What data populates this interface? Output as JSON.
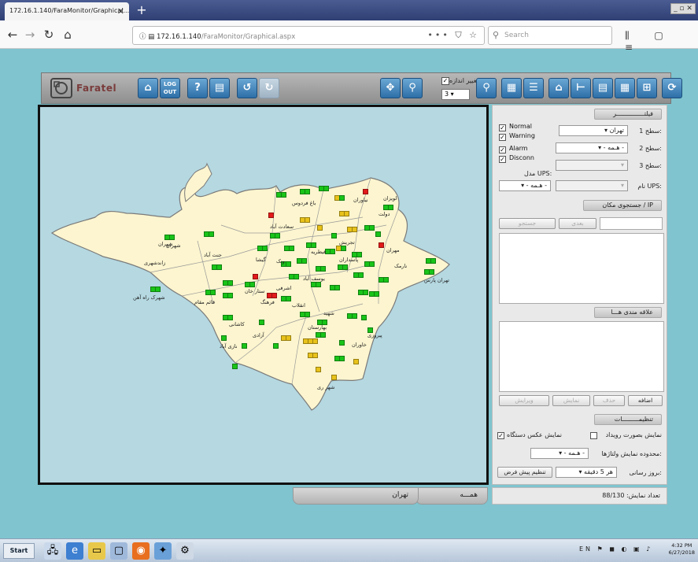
{
  "browser": {
    "tab_title": "172.16.1.140/FaraMonitor/Graphical...",
    "new_tab": "+",
    "window_controls": "_ ▫ ✕",
    "url_host": "172.16.1.140",
    "url_path": "/FaraMonitor/Graphical.aspx",
    "url_icons": "••• ⛉ ☆",
    "search_placeholder": "Search",
    "nav_right_icons": "⫼ ▢ ≡"
  },
  "toolbar": {
    "logo_text": "Faratel",
    "logout_label": "LOG OUT",
    "resize_label": "تغییر اندازه",
    "resize_value": "3",
    "resize_checked": "✓"
  },
  "map": {
    "labels": [
      {
        "t": "شهران"
      },
      {
        "t": "جنت آباد"
      },
      {
        "t": "زاندشهری"
      },
      {
        "t": "شهرک راه آهن"
      },
      {
        "t": "قائم مقام"
      },
      {
        "t": "ستار خان"
      },
      {
        "t": "اشرفی"
      },
      {
        "t": "فرهنگ"
      },
      {
        "t": "نیاوران"
      },
      {
        "t": "قیطریه"
      },
      {
        "t": "پاسداران"
      },
      {
        "t": "تجریش"
      },
      {
        "t": "مهران"
      },
      {
        "t": "نارمک"
      },
      {
        "t": "تهران پارس"
      },
      {
        "t": "سعادت آباد"
      },
      {
        "t": "ونک"
      },
      {
        "t": "یوسف آباد"
      },
      {
        "t": "انقلاب"
      },
      {
        "t": "بهارستان"
      },
      {
        "t": "نازی آباد"
      },
      {
        "t": "شهر ری"
      },
      {
        "t": "خاوران"
      },
      {
        "t": "پیروزی"
      },
      {
        "t": "شهید"
      },
      {
        "t": "کاشانی"
      },
      {
        "t": "آزادی"
      },
      {
        "t": "شهران"
      },
      {
        "t": "باغ فردوس"
      },
      {
        "t": "دولت"
      },
      {
        "t": "لویزان"
      },
      {
        "t": "گیشا"
      }
    ]
  },
  "panel": {
    "filter_title": "فیلتـــــــــــــــر",
    "status_normal": "Normal",
    "status_warning": "Warning",
    "status_alarm": "Alarm",
    "status_disconn": "Disconn",
    "check": "✓",
    "level1_label": "سطح 1:",
    "level1_value": "تهران",
    "level2_label": "سطح 2:",
    "level2_value": "- هـمه -",
    "level3_label": "سطح 3:",
    "ups_name_label": "نام UPS:",
    "ups_model_label": "مدل UPS:",
    "ups_model_value": "- هـمه -",
    "search_title": "جستجوی مکان / IP",
    "search_btn1": "جستجو",
    "search_btn2": "بعدی",
    "search_btn3": "قبلی",
    "favorites_title": "علاقه مندی هـــا",
    "add_button": "اضافه",
    "fav_btn2": "حذف",
    "fav_btn3": "نمایش",
    "fav_btn4": "ویرایش",
    "settings_title": "تنظیمـــــــــات",
    "show_event": "نمایش بصورت رویداد",
    "show_photo": "نمایش عکس دستگاه",
    "range_label": "محدوده نمایش ولتاژها:",
    "range_value": "- هـمه -",
    "refresh_label": "بروز رسانی:",
    "refresh_value": "هر 5 دقیقه",
    "default_btn": "تنظیم پیش فرض"
  },
  "footer": {
    "tab_all": "همـــه",
    "tab_tehran": "تهران",
    "count_text": "تعداد نمایش: 88/130"
  },
  "taskbar": {
    "start": "Start",
    "tray": "EN",
    "time": "4:32 PM",
    "date": "6/27/2018"
  }
}
